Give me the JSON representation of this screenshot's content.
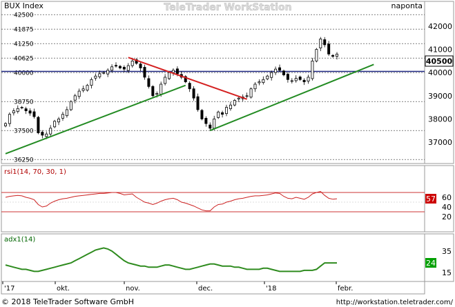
{
  "instrument": "BUX Index",
  "period": "naponta",
  "watermark": "TeleTrader WorkStation",
  "footer": {
    "copyright": "© 2018 TeleTrader Software GmbH",
    "url": "http://workstation.teletrader.com/"
  },
  "colors": {
    "frame": "#999999",
    "candle": "#000000",
    "blue_line": "#1a237e",
    "green_trend": "#228b22",
    "red_trend": "#d42020",
    "rsi_line": "#cc2020",
    "rsi_band": "#cc3333",
    "adx_line": "#2e8b1e",
    "rsi_label": "#b00000",
    "adx_label": "#006400"
  },
  "chart_data": [
    {
      "type": "candlestick",
      "name": "BUX Index",
      "last_value_label": "40500",
      "y_left_ticks": [
        "42500",
        "41875",
        "41250",
        "40625",
        "40000",
        "38750",
        "37500",
        "36250"
      ],
      "y_right_ticks": [
        "42000",
        "41000",
        "40000",
        "39000",
        "38000",
        "37000"
      ],
      "x_ticks": [
        "'17",
        "okt.",
        "nov.",
        "dec.",
        "'18",
        "febr."
      ],
      "horizontal_level": 40050,
      "close_series": [
        37800,
        38200,
        38350,
        38450,
        38500,
        38350,
        38250,
        38100,
        37400,
        37300,
        37350,
        37600,
        37900,
        38000,
        38200,
        38400,
        38750,
        39000,
        39200,
        39300,
        39450,
        39700,
        39850,
        39950,
        40000,
        40100,
        40250,
        40300,
        40200,
        40150,
        40300,
        40500,
        40400,
        40200,
        39800,
        39400,
        39000,
        39100,
        39500,
        39800,
        40000,
        40100,
        39950,
        39800,
        39600,
        39300,
        38900,
        38400,
        38000,
        37800,
        37600,
        38000,
        38300,
        38200,
        38500,
        38600,
        38800,
        38900,
        38950,
        39000,
        39300,
        39500,
        39600,
        39700,
        39850,
        40000,
        40150,
        40100,
        39900,
        39700,
        39650,
        39750,
        39700,
        39600,
        39800,
        40500,
        41000,
        41450,
        41200,
        40800,
        40700,
        40800
      ],
      "trendlines": [
        {
          "color": "green",
          "from": {
            "t": 0,
            "v": 36500
          },
          "to": {
            "t": 44,
            "v": 39450
          }
        },
        {
          "color": "red",
          "from": {
            "t": 30,
            "v": 40650
          },
          "to": {
            "t": 59,
            "v": 38850
          }
        },
        {
          "color": "green",
          "from": {
            "t": 50,
            "v": 37500
          },
          "to": {
            "t": 90,
            "v": 40350
          }
        }
      ]
    },
    {
      "type": "line",
      "name": "rsi1(14, 70, 30, 1)",
      "value_label": "57",
      "y_ticks": [
        "60",
        "40",
        "20"
      ],
      "bands": [
        70,
        30
      ],
      "values": [
        60,
        62,
        63,
        64,
        63,
        60,
        58,
        55,
        45,
        40,
        42,
        48,
        52,
        55,
        57,
        58,
        60,
        62,
        63,
        64,
        65,
        66,
        67,
        68,
        68,
        69,
        70,
        70,
        68,
        65,
        66,
        67,
        60,
        55,
        50,
        48,
        45,
        48,
        52,
        55,
        57,
        58,
        55,
        50,
        48,
        45,
        42,
        38,
        34,
        32,
        32,
        40,
        45,
        46,
        50,
        52,
        55,
        57,
        58,
        60,
        62,
        63,
        63,
        64,
        65,
        67,
        69,
        68,
        62,
        58,
        57,
        60,
        58,
        56,
        60,
        67,
        70,
        72,
        64,
        58,
        56,
        57
      ]
    },
    {
      "type": "line",
      "name": "adx1(14)",
      "value_label": "24",
      "y_ticks": [
        "35",
        "15"
      ],
      "values": [
        22,
        21,
        20,
        19,
        18,
        18,
        17,
        16,
        16,
        17,
        18,
        19,
        20,
        21,
        22,
        23,
        24,
        26,
        28,
        30,
        32,
        34,
        36,
        37,
        38,
        37,
        35,
        32,
        29,
        26,
        24,
        23,
        22,
        21,
        21,
        20,
        20,
        20,
        21,
        22,
        22,
        21,
        20,
        19,
        18,
        18,
        19,
        20,
        21,
        22,
        23,
        23,
        22,
        21,
        21,
        21,
        20,
        20,
        19,
        18,
        18,
        18,
        18,
        19,
        19,
        18,
        17,
        16,
        16,
        16,
        16,
        16,
        16,
        17,
        17,
        17,
        18,
        21,
        24,
        24,
        24,
        24
      ]
    }
  ]
}
